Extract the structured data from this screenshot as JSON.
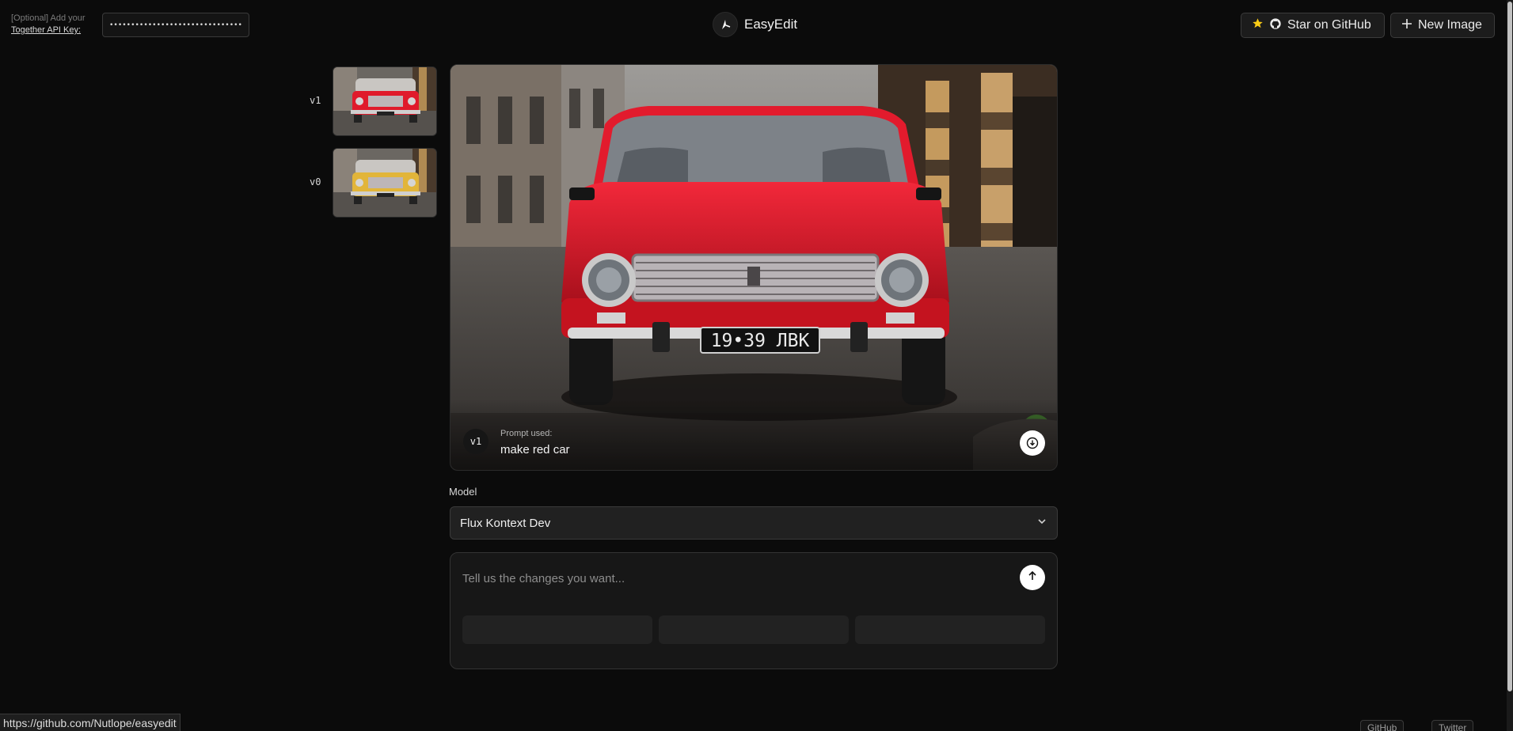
{
  "header": {
    "api_hint": "[Optional] Add your",
    "api_link": "Together API Key:",
    "api_value": "••••••••••••••••••••••••••••••••••••••••",
    "brand": "EasyEdit",
    "star_label": "Star on GitHub",
    "new_label": "New Image",
    "star_color": "#facc15"
  },
  "versions": [
    {
      "label": "v1",
      "car_color": "#e01a2b"
    },
    {
      "label": "v0",
      "car_color": "#e2b53a"
    }
  ],
  "main_image": {
    "version": "v1",
    "prompt_label": "Prompt used:",
    "prompt": "make red car",
    "plate": "19•39 ЛВК",
    "car_color": "#e01a2b"
  },
  "model": {
    "label": "Model",
    "selected": "Flux Kontext Dev"
  },
  "prompt_input": {
    "placeholder": "Tell us the changes you want..."
  },
  "status_bar": {
    "url": "https://github.com/Nutlope/easyedit"
  },
  "footer": {
    "github": "GitHub",
    "twitter": "Twitter"
  }
}
